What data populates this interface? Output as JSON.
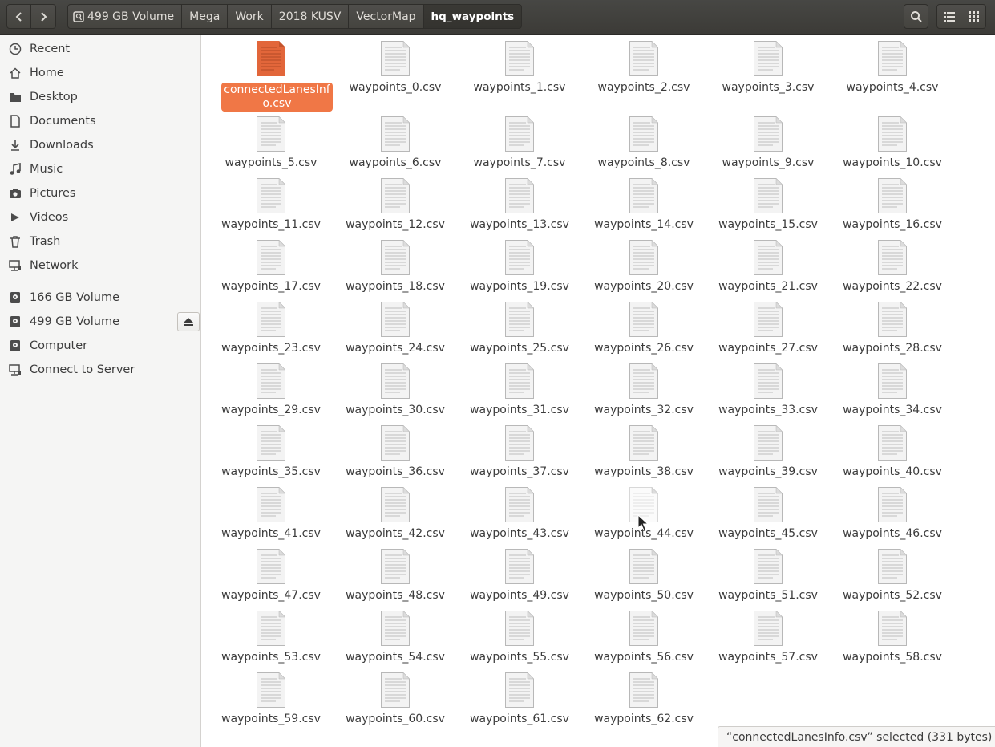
{
  "header": {
    "breadcrumbs": [
      "499 GB Volume",
      "Mega",
      "Work",
      "2018 KUSV",
      "VectorMap",
      "hq_waypoints"
    ]
  },
  "sidebar": {
    "places": [
      {
        "label": "Recent",
        "icon": "clock-icon"
      },
      {
        "label": "Home",
        "icon": "home-icon"
      },
      {
        "label": "Desktop",
        "icon": "folder-icon"
      },
      {
        "label": "Documents",
        "icon": "document-icon"
      },
      {
        "label": "Downloads",
        "icon": "download-icon"
      },
      {
        "label": "Music",
        "icon": "music-icon"
      },
      {
        "label": "Pictures",
        "icon": "camera-icon"
      },
      {
        "label": "Videos",
        "icon": "video-icon"
      },
      {
        "label": "Trash",
        "icon": "trash-icon"
      },
      {
        "label": "Network",
        "icon": "network-icon"
      }
    ],
    "devices": [
      {
        "label": "166 GB Volume",
        "icon": "drive-icon"
      },
      {
        "label": "499 GB Volume",
        "icon": "drive-icon"
      },
      {
        "label": "Computer",
        "icon": "computer-icon"
      },
      {
        "label": "Connect to Server",
        "icon": "server-icon"
      }
    ]
  },
  "files": {
    "selected_name": "connectedLanesInfo.csv",
    "names": [
      "waypoints_0.csv",
      "waypoints_1.csv",
      "waypoints_2.csv",
      "waypoints_3.csv",
      "waypoints_4.csv",
      "waypoints_5.csv",
      "waypoints_6.csv",
      "waypoints_7.csv",
      "waypoints_8.csv",
      "waypoints_9.csv",
      "waypoints_10.csv",
      "waypoints_11.csv",
      "waypoints_12.csv",
      "waypoints_13.csv",
      "waypoints_14.csv",
      "waypoints_15.csv",
      "waypoints_16.csv",
      "waypoints_17.csv",
      "waypoints_18.csv",
      "waypoints_19.csv",
      "waypoints_20.csv",
      "waypoints_21.csv",
      "waypoints_22.csv",
      "waypoints_23.csv",
      "waypoints_24.csv",
      "waypoints_25.csv",
      "waypoints_26.csv",
      "waypoints_27.csv",
      "waypoints_28.csv",
      "waypoints_29.csv",
      "waypoints_30.csv",
      "waypoints_31.csv",
      "waypoints_32.csv",
      "waypoints_33.csv",
      "waypoints_34.csv",
      "waypoints_35.csv",
      "waypoints_36.csv",
      "waypoints_37.csv",
      "waypoints_38.csv",
      "waypoints_39.csv",
      "waypoints_40.csv",
      "waypoints_41.csv",
      "waypoints_42.csv",
      "waypoints_43.csv",
      "waypoints_44.csv",
      "waypoints_45.csv",
      "waypoints_46.csv",
      "waypoints_47.csv",
      "waypoints_48.csv",
      "waypoints_49.csv",
      "waypoints_50.csv",
      "waypoints_51.csv",
      "waypoints_52.csv",
      "waypoints_53.csv",
      "waypoints_54.csv",
      "waypoints_55.csv",
      "waypoints_56.csv",
      "waypoints_57.csv",
      "waypoints_58.csv",
      "waypoints_59.csv",
      "waypoints_60.csv",
      "waypoints_61.csv",
      "waypoints_62.csv"
    ]
  },
  "statusbar": {
    "text": "“connectedLanesInfo.csv” selected  (331 bytes)"
  },
  "colors": {
    "accent": "#f07746",
    "headerbar": "#3c3b37",
    "sidebar": "#f5f5f4"
  }
}
